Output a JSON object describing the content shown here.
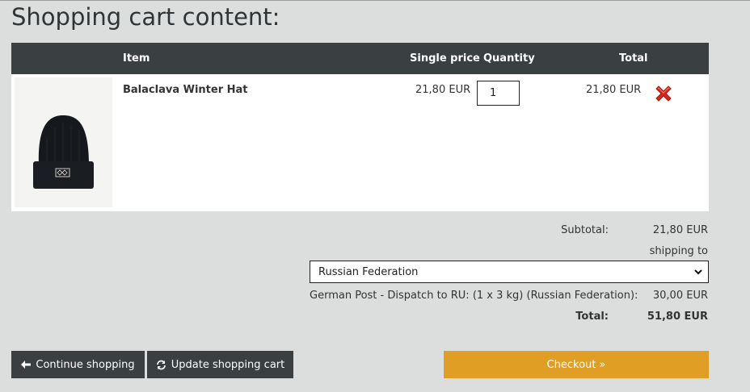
{
  "page": {
    "title": "Shopping cart content:"
  },
  "table": {
    "headers": {
      "item": "Item",
      "single_price": "Single price",
      "quantity": "Quantity",
      "total": "Total"
    },
    "rows": [
      {
        "name": "Balaclava Winter Hat",
        "single_price": "21,80 EUR",
        "quantity": "1",
        "total": "21,80 EUR"
      }
    ]
  },
  "summary": {
    "subtotal_label": "Subtotal:",
    "subtotal_value": "21,80 EUR",
    "shipping_to_label": "shipping to",
    "country_selected": "Russian Federation",
    "shipping_method": "German Post - Dispatch to RU: (1 x 3 kg) (Russian Federation):",
    "shipping_cost": "30,00 EUR",
    "total_label": "Total:",
    "total_value": "51,80 EUR"
  },
  "buttons": {
    "continue_label": "Continue shopping",
    "update_label": "Update shopping cart",
    "checkout_label": "Checkout »"
  },
  "colors": {
    "header_bg": "#3a3f42",
    "checkout": "#e09e24",
    "remove": "#d9261c",
    "page_bg": "#dcdedd"
  },
  "icons": {
    "remove": "remove-x-icon",
    "continue": "arrow-left-icon",
    "update": "refresh-icon"
  }
}
